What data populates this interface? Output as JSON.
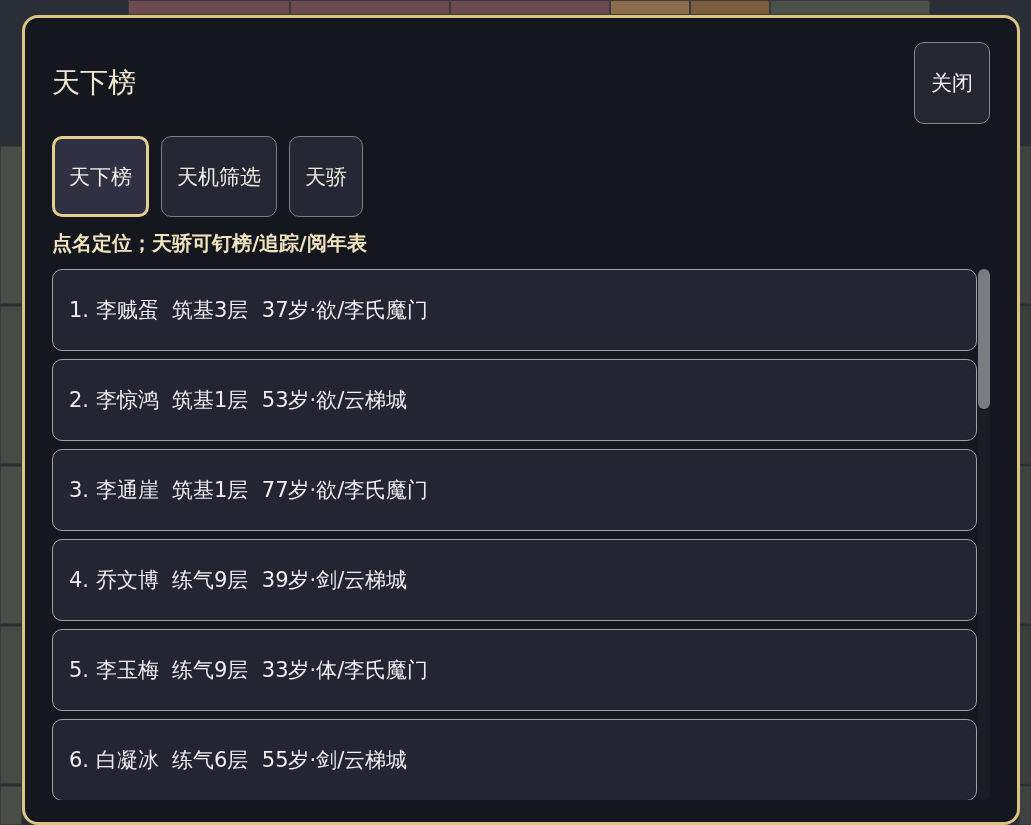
{
  "dialog": {
    "title": "天下榜",
    "close_button": "关闭"
  },
  "tabs": [
    {
      "label": "天下榜",
      "selected": true
    },
    {
      "label": "天机筛选",
      "selected": false
    },
    {
      "label": "天骄",
      "selected": false
    }
  ],
  "hint": "点名定位；天骄可钉榜/追踪/阅年表",
  "ranking": [
    {
      "text": "1. 李贼蛋  筑基3层  37岁·欲/李氏魔门"
    },
    {
      "text": "2. 李惊鸿  筑基1层  53岁·欲/云梯城"
    },
    {
      "text": "3. 李通崖  筑基1层  77岁·欲/李氏魔门"
    },
    {
      "text": "4. 乔文博  练气9层  39岁·剑/云梯城"
    },
    {
      "text": "5. 李玉梅  练气9层  33岁·体/李氏魔门"
    },
    {
      "text": "6. 白凝冰  练气6层  55岁·剑/云梯城"
    }
  ]
}
